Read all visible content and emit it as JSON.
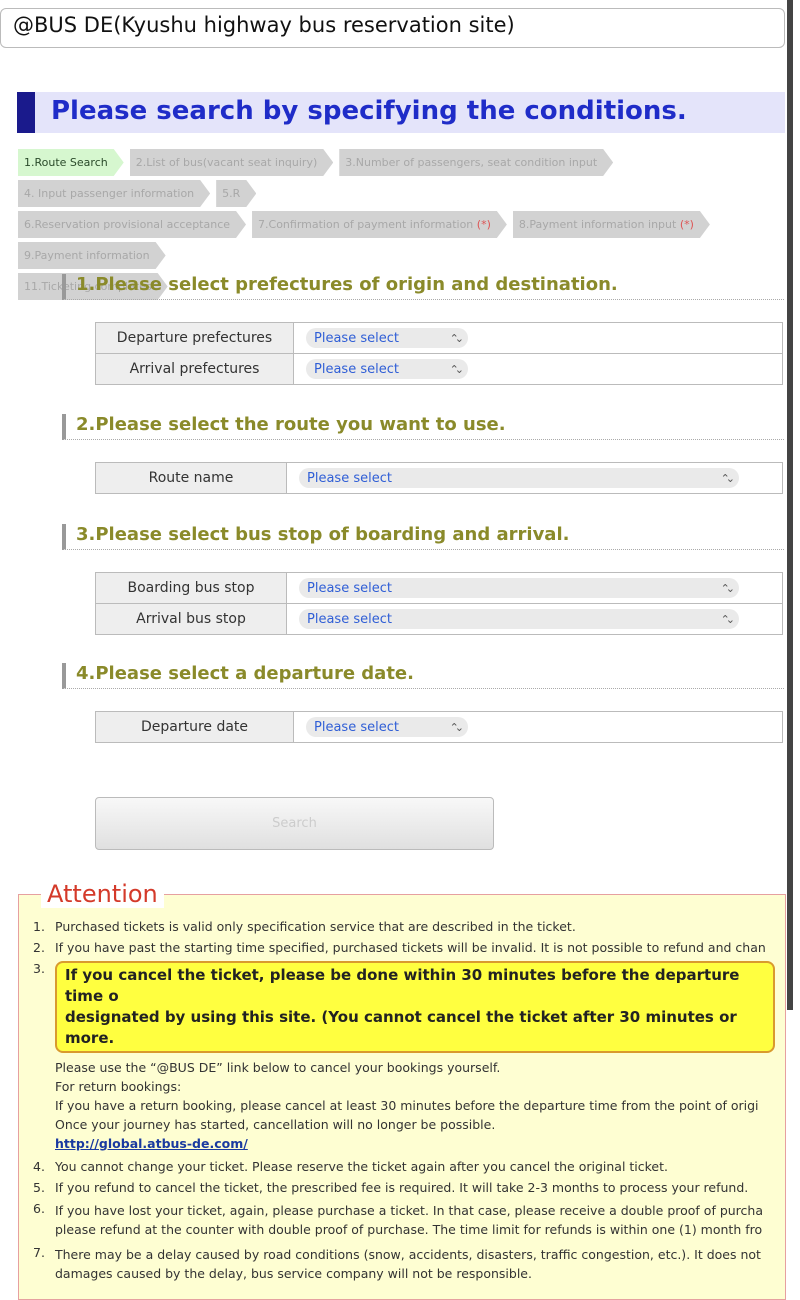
{
  "window": {
    "title": "@BUS DE(Kyushu highway bus reservation site)"
  },
  "banner": "Please search by specifying the conditions.",
  "steps": [
    [
      {
        "label": "1.Route Search",
        "active": true
      },
      {
        "label": "2.List of bus(vacant seat inquiry)"
      },
      {
        "label": "3.Number of passengers, seat condition input"
      },
      {
        "label": "4. Input passenger information"
      },
      {
        "label": "5.R"
      }
    ],
    [
      {
        "label": "6.Reservation provisional acceptance"
      },
      {
        "label": "7.Confirmation of payment information ",
        "req": "(*)"
      },
      {
        "label": "8.Payment information input ",
        "req": "(*)"
      },
      {
        "label": "9.Payment information"
      }
    ],
    [
      {
        "label": "11.Ticketing completes"
      }
    ]
  ],
  "sections": {
    "s1": {
      "title": "1.Please select prefectures of origin and destination.",
      "rows": [
        {
          "label": "Departure prefectures",
          "value": "Please select"
        },
        {
          "label": "Arrival prefectures",
          "value": "Please select"
        }
      ]
    },
    "s2": {
      "title": "2.Please select the route you want to use.",
      "rows": [
        {
          "label": "Route name",
          "value": "Please select"
        }
      ]
    },
    "s3": {
      "title": "3.Please select bus stop of boarding and arrival.",
      "rows": [
        {
          "label": "Boarding bus stop",
          "value": "Please select"
        },
        {
          "label": "Arrival bus stop",
          "value": "Please select"
        }
      ]
    },
    "s4": {
      "title": "4.Please select a departure date.",
      "rows": [
        {
          "label": "Departure date",
          "value": "Please select"
        }
      ]
    }
  },
  "search_label": "Search",
  "attention": {
    "title": "Attention",
    "items": [
      {
        "num": "1.",
        "text": "Purchased tickets is valid only specification service that are described in the ticket."
      },
      {
        "num": "2.",
        "text": "If you have past the starting time specified, purchased tickets will be invalid. It is not possible to refund and chan"
      },
      {
        "num": "3.",
        "highlight": [
          "If you cancel the ticket, please be done within 30 minutes before the departure time o",
          "designated by using this site. (You cannot cancel the ticket after 30 minutes or more."
        ],
        "sub": [
          "Please use the “@BUS DE” link below to cancel your bookings yourself.",
          "For return bookings:",
          "If you have a return booking, please cancel at least 30 minutes before the departure time from the point of origi",
          "Once your journey has started, cancellation will no longer be possible."
        ],
        "link": "http://global.atbus-de.com/"
      },
      {
        "num": "4.",
        "text": "You cannot change your ticket. Please reserve the ticket again after you cancel the original ticket."
      },
      {
        "num": "5.",
        "text": "If you refund to cancel the ticket, the prescribed fee is required. It will take 2-3 months to process your refund."
      },
      {
        "num": "6.",
        "lines": [
          "If you have lost your ticket, again, please purchase a ticket. In that case, please receive a double proof of purcha",
          "please refund at the counter with double proof of purchase. The time limit for refunds is within one (1) month fro"
        ]
      },
      {
        "num": "7.",
        "lines": [
          "There may be a delay caused by road conditions (snow, accidents, disasters, traffic congestion, etc.). It does not",
          "damages caused by the delay, bus service company will not be responsible."
        ]
      }
    ]
  }
}
